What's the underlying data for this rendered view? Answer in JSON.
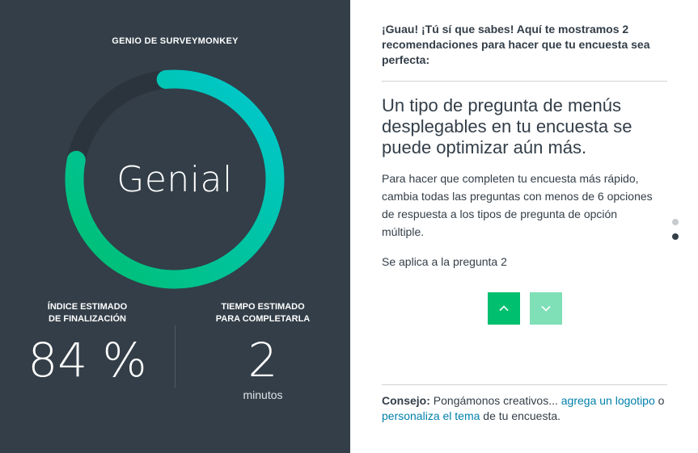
{
  "genius": {
    "title": "GENIO DE SURVEYMONKEY",
    "rating": "Genial",
    "gauge_fraction": 0.9,
    "colors": {
      "start": "#00bf6f",
      "end": "#00c8d2",
      "track": "#2b343d",
      "background": "#333e48"
    }
  },
  "metrics": {
    "completion": {
      "label": "ÍNDICE ESTIMADO\nDE FINALIZACIÓN",
      "value": "84 %"
    },
    "time": {
      "label": "TIEMPO ESTIMADO\nPARA COMPLETARLA",
      "value": "2",
      "unit": "minutos"
    }
  },
  "recommendations": {
    "intro": "¡Guau! ¡Tú sí que sabes! Aquí te mostramos 2 recomendaciones para hacer que tu encuesta sea perfecta:",
    "current": {
      "title": "Un tipo de pregunta de menús desplegables en tu encuesta se puede optimizar aún más.",
      "body": "Para hacer que completen tu encuesta más rápido, cambia todas las preguntas con menos de 6 opciones de respuesta a los tipos de pregunta de opción múltiple.",
      "applies_to": "Se aplica a la pregunta 2"
    },
    "nav": {
      "up_icon": "chevron-up-icon",
      "down_icon": "chevron-down-icon"
    },
    "pagination": {
      "total": 2,
      "current": 2
    }
  },
  "tip": {
    "label": "Consejo:",
    "text_1": " Pongámonos creativos... ",
    "link_1": "agrega un logotipo",
    "text_2": " o ",
    "link_2": "personaliza el tema",
    "text_3": " de tu encuesta."
  },
  "colors": {
    "accent_green": "#00bf6f",
    "accent_green_light": "#7fdfb7",
    "link": "#007faa",
    "text_dark": "#333e48"
  }
}
